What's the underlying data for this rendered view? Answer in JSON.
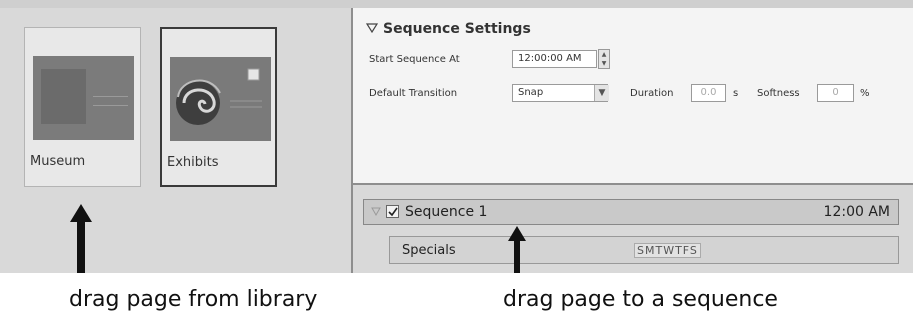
{
  "library": {
    "pages": [
      {
        "label": "Museum"
      },
      {
        "label": "Exhibits"
      }
    ]
  },
  "settings": {
    "header": "Sequence Settings",
    "start_label": "Start Sequence At",
    "start_value": "12:00:00 AM",
    "transition_label": "Default Transition",
    "transition_value": "Snap",
    "duration_label": "Duration",
    "duration_value": "0.0",
    "duration_unit": "s",
    "softness_label": "Softness",
    "softness_value": "0",
    "softness_unit": "%"
  },
  "sequence": {
    "name": "Sequence 1",
    "time": "12:00 AM",
    "page_name": "Specials",
    "days": "SMTWTFS"
  },
  "captions": {
    "left": "drag page from library",
    "right": "drag page to a sequence"
  }
}
